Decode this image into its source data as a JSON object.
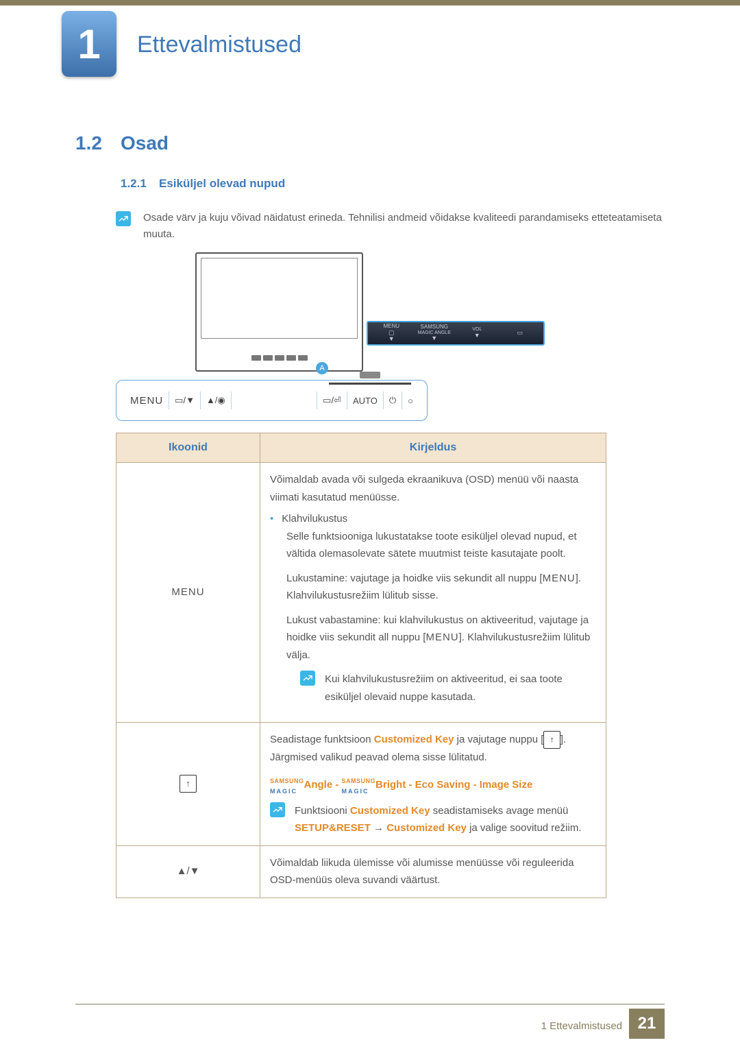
{
  "chapter": {
    "number": "1",
    "title": "Ettevalmistused"
  },
  "section": {
    "number": "1.2",
    "title": "Osad"
  },
  "subsection": {
    "number": "1.2.1",
    "title": "Esiküljel olevad nupud"
  },
  "intro": "Osade värv ja kuju võivad näidatust erineda. Tehnilisi andmeid võidakse kvaliteedi parandamiseks etteteatamiseta muuta.",
  "callout_a": "A",
  "zoom_panel": {
    "c1_top": "MENU",
    "c2_top": "SAMSUNG",
    "c2_mid": "MAGIC ANGLE",
    "c3_mid": "VOL"
  },
  "button_strip": {
    "menu": "MENU",
    "auto": "AUTO"
  },
  "table": {
    "h1": "Ikoonid",
    "h2": "Kirjeldus",
    "row1": {
      "icon": "MENU",
      "p1": "Võimaldab avada või sulgeda ekraanikuva (OSD) menüü või naasta viimati kasutatud menüüsse.",
      "bullet": "Klahvilukustus",
      "p2a": "Selle funktsiooniga lukustatakse toote esiküljel olevad nupud, et vältida olemasolevate sätete muutmist teiste kasutajate poolt.",
      "p3a": "Lukustamine: vajutage ja hoidke viis sekundit all nuppu [",
      "p3b": "]. Klahvilukustusrežiim lülitub sisse.",
      "p4a": "Lukust vabastamine: kui klahvilukustus on aktiveeritud, vajutage ja hoidke viis sekundit all nuppu [",
      "p4b": "]. Klahvilukustusrežiim lülitub välja.",
      "note": "Kui klahvilukustusrežiim on aktiveeritud, ei saa toote esiküljel olevaid nuppe kasutada.",
      "menu_inline": "MENU"
    },
    "row2": {
      "p1a": "Seadistage funktsioon ",
      "ck": "Customized Key",
      "p1b": " ja vajutage nuppu [",
      "p1c": "]. Järgmised valikud peavad olema sisse lülitatud.",
      "magic_top": "SAMSUNG",
      "magic_bot": "MAGIC",
      "angle": "Angle",
      "bright": "Bright",
      "eco": "Eco Saving",
      "image": "Image Size",
      "dash": " - ",
      "note_a": "Funktsiooni ",
      "note_b": " seadistamiseks avage menüü",
      "setup": "SETUP&RESET",
      "arrow": "  →  ",
      "tail": " ja valige soovitud režiim."
    },
    "row3": {
      "icon": "▲/▼",
      "text": "Võimaldab liikuda ülemisse või alumisse menüüsse või reguleerida OSD-menüüs oleva suvandi väärtust."
    }
  },
  "footer": {
    "chapter": "1 Ettevalmistused",
    "page": "21"
  }
}
